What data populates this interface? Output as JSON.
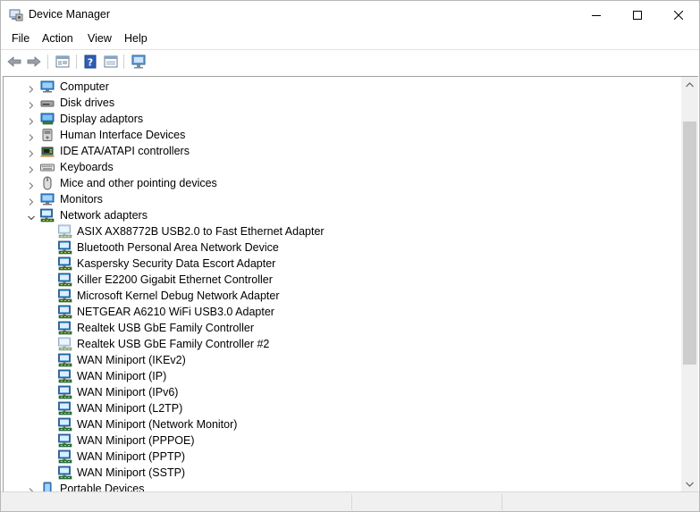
{
  "window": {
    "title": "Device Manager"
  },
  "menu": [
    {
      "label": "File"
    },
    {
      "label": "Action"
    },
    {
      "label": "View"
    },
    {
      "label": "Help"
    }
  ],
  "toolbar": {
    "buttons": [
      {
        "icon": "back-arrow-icon"
      },
      {
        "icon": "forward-arrow-icon"
      },
      {
        "icon": "properties-console-icon"
      },
      {
        "icon": "help-icon"
      },
      {
        "icon": "update-driver-icon"
      },
      {
        "icon": "scan-hardware-icon"
      }
    ]
  },
  "tree": {
    "categories": [
      {
        "label": "Computer",
        "icon": "computer-icon",
        "expanded": false
      },
      {
        "label": "Disk drives",
        "icon": "disk-drive-icon",
        "expanded": false
      },
      {
        "label": "Display adaptors",
        "icon": "display-adapter-icon",
        "expanded": false
      },
      {
        "label": "Human Interface Devices",
        "icon": "hid-icon",
        "expanded": false
      },
      {
        "label": "IDE ATA/ATAPI controllers",
        "icon": "ide-controller-icon",
        "expanded": false
      },
      {
        "label": "Keyboards",
        "icon": "keyboard-icon",
        "expanded": false
      },
      {
        "label": "Mice and other pointing devices",
        "icon": "mouse-icon",
        "expanded": false
      },
      {
        "label": "Monitors",
        "icon": "monitor-icon",
        "expanded": false
      },
      {
        "label": "Network adapters",
        "icon": "network-adapter-icon",
        "expanded": true
      }
    ],
    "network_adapters": [
      {
        "label": "ASIX AX88772B USB2.0 to Fast Ethernet Adapter",
        "disabled": true
      },
      {
        "label": "Bluetooth Personal Area Network Device",
        "disabled": false
      },
      {
        "label": "Kaspersky Security Data Escort Adapter",
        "disabled": false
      },
      {
        "label": "Killer E2200 Gigabit Ethernet Controller",
        "disabled": false
      },
      {
        "label": "Microsoft Kernel Debug Network Adapter",
        "disabled": false
      },
      {
        "label": "NETGEAR A6210 WiFi USB3.0 Adapter",
        "disabled": false
      },
      {
        "label": "Realtek USB GbE Family Controller",
        "disabled": false
      },
      {
        "label": "Realtek USB GbE Family Controller #2",
        "disabled": true
      },
      {
        "label": "WAN Miniport (IKEv2)",
        "disabled": false
      },
      {
        "label": "WAN Miniport (IP)",
        "disabled": false
      },
      {
        "label": "WAN Miniport (IPv6)",
        "disabled": false
      },
      {
        "label": "WAN Miniport (L2TP)",
        "disabled": false
      },
      {
        "label": "WAN Miniport (Network Monitor)",
        "disabled": false
      },
      {
        "label": "WAN Miniport (PPPOE)",
        "disabled": false
      },
      {
        "label": "WAN Miniport (PPTP)",
        "disabled": false
      },
      {
        "label": "WAN Miniport (SSTP)",
        "disabled": false
      }
    ],
    "after": [
      {
        "label": "Portable Devices",
        "icon": "portable-device-icon",
        "expanded": false
      }
    ]
  },
  "colors": {
    "accent": "#0078d7",
    "network_icon": "#1e73be",
    "disabled_network_icon": "#9cc3e5"
  }
}
